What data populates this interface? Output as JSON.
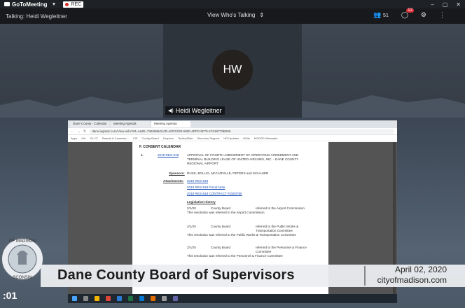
{
  "app": {
    "name": "GoToMeeting",
    "rec_label": "REC",
    "talking_label": "Talking: Heidi Wegleitner",
    "view_label": "View Who's Talking",
    "attendees_count": "51",
    "chat_count": "12"
  },
  "video": {
    "initials": "HW",
    "participant_name": "Heidi Wegleitner"
  },
  "browser": {
    "tabs": [
      "Dane County - Calendar",
      "Meeting Agenda",
      "Meeting Agenda"
    ],
    "url": "dane.legistar.com/View.ashx?M=A&ID=736598&GUID=E0F0239-5980-4DFD-9F79-2C618778B055",
    "bookmarks": [
      "Apps",
      "Ctrl",
      "Ctrl 'C'",
      "Boards & Commiss...",
      "CIS",
      "County Board",
      "Dropbox",
      "TechbySlide",
      "Diversion Support",
      "HR Updates",
      "HSite",
      "MODSD Webcasts"
    ]
  },
  "document": {
    "section": "F.  CONSENT CALENDAR",
    "item_number": "1.",
    "item_id": "2019 RES-518",
    "item_text_1": "APPROVAL OF FOURTH AMENDMENT OF OPERATING AGREEMENT AND",
    "item_text_2": "TERMINAL BUILDING LEASE OF UNITED AIRLINES, INC. - DANE COUNTY",
    "item_text_3": "REGIONAL AIRPORT",
    "sponsors_label": "Sponsors:",
    "sponsors": "RUSK, BOLLIG, McCARVILLE, PETERS and SCHAUER",
    "attachments_label": "Attachments:",
    "attachments": [
      "2019 RES-518",
      "2019 RES-518 Fiscal Note",
      "2019 RES-518 CONTRACT #1504780"
    ],
    "history_label": "Legislative History",
    "history": [
      {
        "date": "2/1/20",
        "body": "County Board",
        "action": "referred to the Airport Commission",
        "note": "This resolution was referred to the Airport Commission"
      },
      {
        "date": "2/1/20",
        "body": "County Board",
        "action": "referred to the Public Works & Transportation Committee",
        "note": "This resolution was referred to the Public Works & Transportation Committee"
      },
      {
        "date": "2/1/20",
        "body": "County Board",
        "action": "referred to the Personnel & Finance Committee",
        "note": "This resolution was referred to the Personnel & Finance Committee"
      }
    ]
  },
  "lower_third": {
    "title": "Dane County Board of Supervisors",
    "date": "April 02, 2020",
    "site": "cityofmadison.com",
    "timer": ":01"
  }
}
